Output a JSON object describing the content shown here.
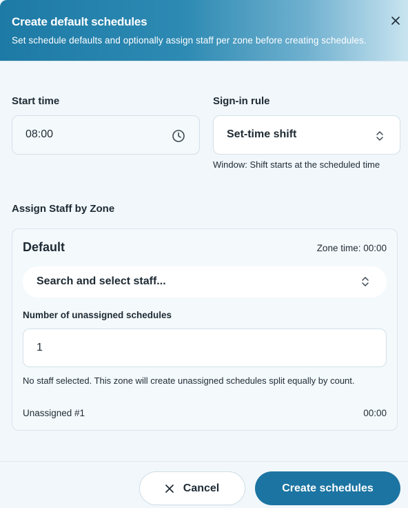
{
  "header": {
    "title": "Create default schedules",
    "subtitle": "Set schedule defaults and optionally assign staff per zone before creating schedules."
  },
  "form": {
    "start_time_label": "Start time",
    "start_time_value": "08:00",
    "sign_in_rule_label": "Sign-in rule",
    "sign_in_rule_value": "Set-time shift",
    "sign_in_rule_help": "Window: Shift starts at the scheduled time"
  },
  "zones": {
    "section_title": "Assign Staff by Zone",
    "items": [
      {
        "name": "Default",
        "zone_time": "Zone time: 00:00",
        "staff_placeholder": "Search and select staff...",
        "unassigned_label": "Number of unassigned schedules",
        "unassigned_value": "1",
        "note": "No staff selected. This zone will create unassigned schedules split equally by count.",
        "schedule_rows": [
          {
            "name": "Unassigned #1",
            "time": "00:00"
          }
        ]
      }
    ]
  },
  "footer": {
    "cancel_label": "Cancel",
    "create_label": "Create schedules"
  },
  "colors": {
    "accent": "#1c74a2",
    "header_gradient_start": "#1d7aa5",
    "background": "#f1f7fb"
  },
  "icons": {
    "close": "close-icon",
    "clock": "clock-icon",
    "select_arrows": "chevron-updown-icon",
    "cancel": "x-icon"
  }
}
